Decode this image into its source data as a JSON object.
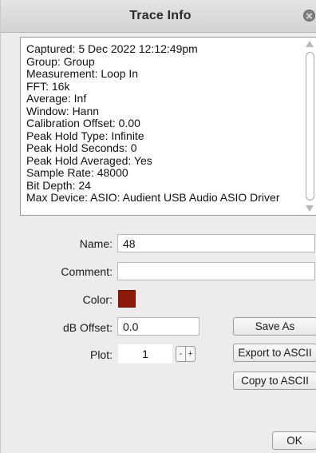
{
  "window": {
    "title": "Trace Info"
  },
  "info": {
    "lines": [
      "Captured: 5 Dec 2022 12:12:49pm",
      "Group: Group",
      "Measurement: Loop In",
      "FFT: 16k",
      "Average: Inf",
      "Window: Hann",
      "Calibration Offset: 0.00",
      "Peak Hold Type: Infinite",
      "Peak Hold Seconds: 0",
      "Peak Hold Averaged: Yes",
      "Sample Rate: 48000",
      "Bit Depth: 24",
      "Max Device: ASIO: Audient USB Audio ASIO Driver"
    ]
  },
  "form": {
    "name_label": "Name:",
    "name_value": "48",
    "comment_label": "Comment:",
    "comment_value": "",
    "color_label": "Color:",
    "color_value": "#8b1a09",
    "db_offset_label": "dB Offset:",
    "db_offset_value": "0.0",
    "plot_label": "Plot:",
    "plot_value": "1",
    "minus": "-",
    "plus": "+"
  },
  "buttons": {
    "save_as": "Save As",
    "export_ascii": "Export to ASCII",
    "copy_ascii": "Copy to ASCII",
    "ok": "OK"
  }
}
